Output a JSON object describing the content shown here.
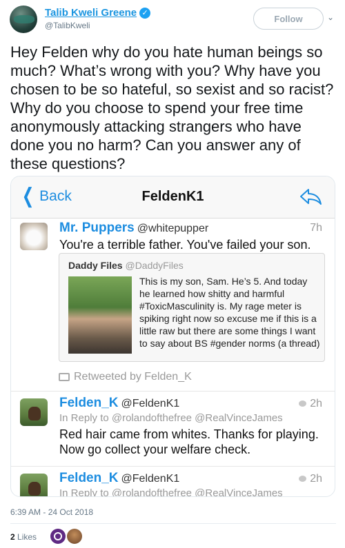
{
  "author": {
    "display_name": "Talib Kweli Greene",
    "handle": "@TalibKweli",
    "verified_icon": "verified-badge-icon",
    "follow_label": "Follow"
  },
  "tweet": {
    "text": "Hey Felden why do you hate human beings so much? What’s wrong with you? Why have you chosen to be so hateful, so sexist and so racist? Why do you choose to spend your free time anonymously attacking strangers who have done you no harm? Can you answer any of these questions?",
    "timestamp": "6:39 AM - 24 Oct 2018",
    "likes_count": "2",
    "likes_label": "Likes"
  },
  "screenshot": {
    "nav": {
      "back_label": "Back",
      "title": "FeldenK1"
    },
    "item1": {
      "name": "Mr. Puppers",
      "handle": "@whitepupper",
      "time": "7h",
      "text": "You're a terrible father. You've failed your son.",
      "quote": {
        "name": "Daddy Files",
        "handle": "@DaddyFiles",
        "text": "This is my son, Sam. He’s 5. And today he learned how shitty and harmful #ToxicMasculinity is. My rage meter is spiking right now so excuse me if this is a little raw but there are some things I want to say about BS #gender norms (a thread)"
      },
      "retweeted_by": "Retweeted by Felden_K"
    },
    "item2": {
      "name": "Felden_K",
      "handle": "@FeldenK1",
      "time": "2h",
      "reply_to": "In Reply to @rolandofthefree @RealVinceJames",
      "text": "Red hair came from whites. Thanks for playing. Now go collect your welfare check."
    },
    "item3": {
      "name": "Felden_K",
      "handle": "@FeldenK1",
      "time": "2h",
      "reply_to": "In Reply to @rolandofthefree @RealVinceJames"
    }
  },
  "colors": {
    "link_blue": "#1b95e0",
    "ios_blue": "#1d8de0",
    "muted": "#657786"
  }
}
